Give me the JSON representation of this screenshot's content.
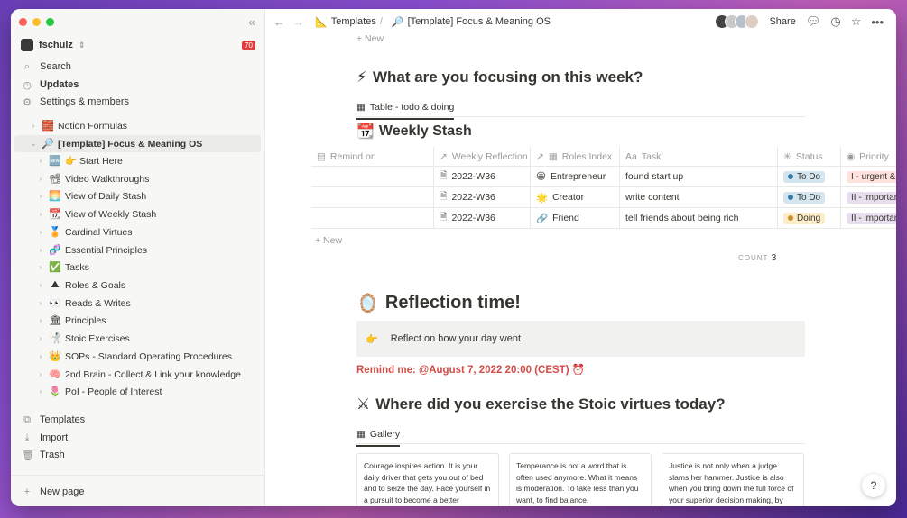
{
  "sidebar": {
    "workspace": "fschulz",
    "badge": "70",
    "top_items": [
      {
        "label": "Search",
        "icon": "⌕"
      },
      {
        "label": "Updates",
        "icon": "◷"
      },
      {
        "label": "Settings & members",
        "icon": "⚙"
      }
    ],
    "tree": [
      {
        "label": "Notion Formulas",
        "emoji": "🧱"
      },
      {
        "label": "[Template] Focus & Meaning OS",
        "emoji": "🔎"
      },
      {
        "label": "👉 Start Here",
        "emoji": "🆕"
      },
      {
        "label": "Video Walkthroughs",
        "emoji": "📽"
      },
      {
        "label": "View of Daily Stash",
        "emoji": "🌅"
      },
      {
        "label": "View of Weekly Stash",
        "emoji": "📆"
      },
      {
        "label": "Cardinal Virtues",
        "emoji": "🏅"
      },
      {
        "label": "Essential Principles",
        "emoji": "🧬"
      },
      {
        "label": "Tasks",
        "emoji": "✅"
      },
      {
        "label": "Roles & Goals",
        "emoji": "⛰"
      },
      {
        "label": "Reads & Writes",
        "emoji": "👀"
      },
      {
        "label": "Principles",
        "emoji": "🏛"
      },
      {
        "label": "Stoic Exercises",
        "emoji": "🤺"
      },
      {
        "label": "SOPs - Standard Operating Procedures",
        "emoji": "👑"
      },
      {
        "label": "2nd Brain - Collect & Link your knowledge",
        "emoji": "🧠"
      },
      {
        "label": "PoI - People of Interest",
        "emoji": "🌷"
      }
    ],
    "bottom_items": [
      {
        "label": "Templates",
        "icon": "⧉"
      },
      {
        "label": "Import",
        "icon": "⤓"
      },
      {
        "label": "Trash",
        "icon": "🗑"
      }
    ],
    "new_page": "New page"
  },
  "topbar": {
    "crumb1": "Templates",
    "crumb2": "[Template] Focus & Meaning OS",
    "share": "Share"
  },
  "main": {
    "new_label": "+ New",
    "focus_heading": "What are you focusing on this week?",
    "focus_emoji": "⚡",
    "table_tab": "Table - todo & doing",
    "stash_heading": "Weekly Stash",
    "stash_emoji": "📆",
    "columns": [
      "Remind on",
      "Weekly Reflection",
      "Roles Index",
      "Task",
      "Status",
      "Priority"
    ],
    "rows": [
      {
        "remind": "",
        "reflection": "2022-W36",
        "role_emoji": "😀",
        "role": "Entrepreneur",
        "task": "found start up",
        "status": "To Do",
        "priority": "I - urgent &"
      },
      {
        "remind": "",
        "reflection": "2022-W36",
        "role_emoji": "🌟",
        "role": "Creator",
        "task": "write content",
        "status": "To Do",
        "priority": "II - importar"
      },
      {
        "remind": "",
        "reflection": "2022-W36",
        "role_emoji": "🔗",
        "role": "Friend",
        "task": "tell friends about being rich",
        "status": "Doing",
        "priority": "II - importar"
      }
    ],
    "table_new": "+ New",
    "count_label": "COUNT",
    "count_value": "3",
    "reflection_heading": "Reflection time!",
    "reflection_emoji": "🪞",
    "callout_emoji": "👉",
    "callout_text": "Reflect on how your day went",
    "remind_text": "Remind me: @August 7, 2022 20:00 (CEST) ⏰",
    "virtues_heading": "Where did you exercise the Stoic virtues today?",
    "virtues_emoji": "⚔",
    "gallery_tab": "Gallery",
    "cards": [
      "Courage inspires action. It is your daily driver that gets you out of bed and to seize the day. Face yourself in a pursuit to become a better",
      "Temperance is not a word that is often used anymore. What it means is moderation. To take less than you want, to find balance.",
      "Justice is not only when a judge slams her hammer. Justice is also when you bring down the full force of your superior decision making, by"
    ],
    "help": "?"
  },
  "colors": {
    "todo_bg": "#d3e5ef",
    "todo_dot": "#337ea9",
    "doing_bg": "#fdecc8",
    "doing_dot": "#cb912f",
    "urgent_bg": "#ffe2dd",
    "important_bg": "#e8deee",
    "remind": "#d44c47"
  }
}
